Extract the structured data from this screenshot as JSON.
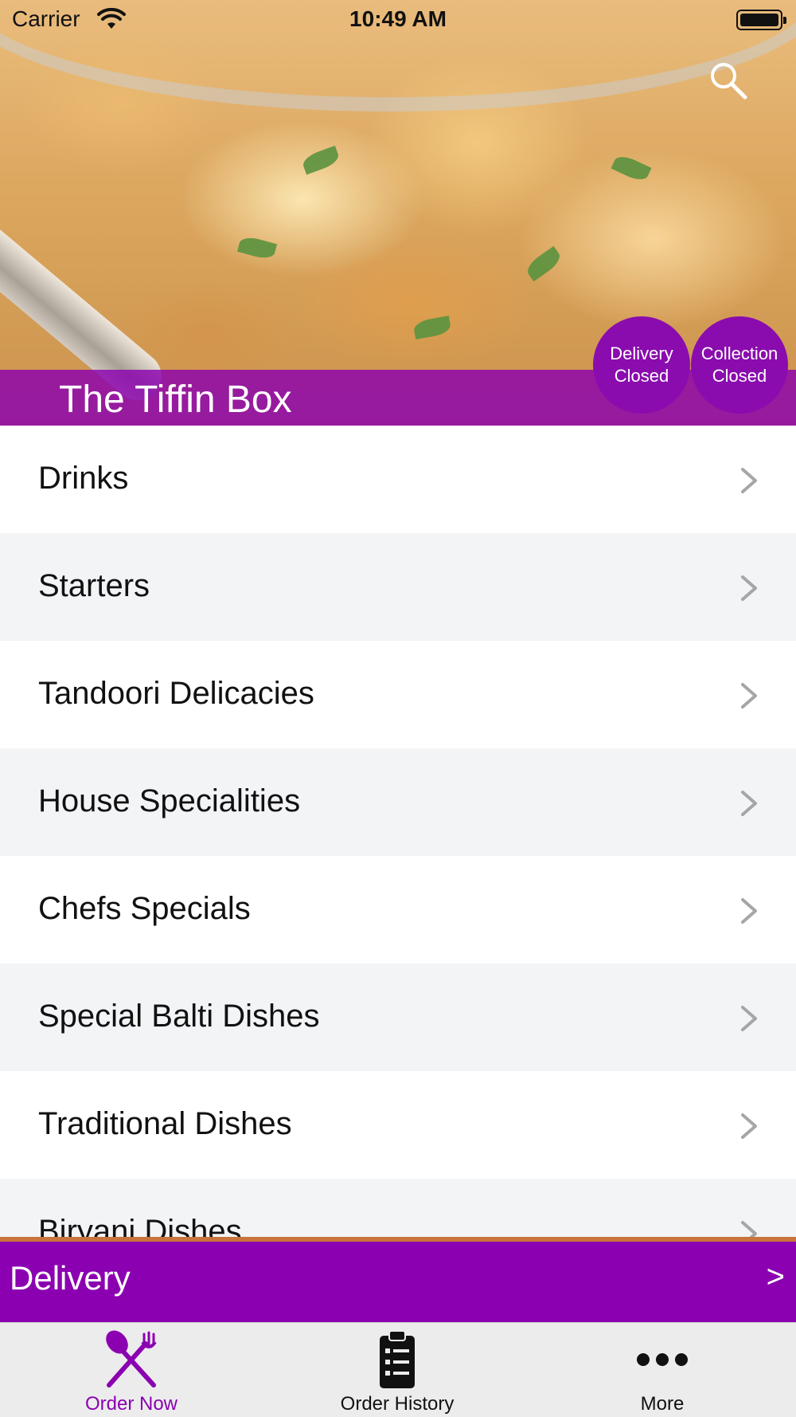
{
  "status_bar": {
    "carrier": "Carrier",
    "time": "10:49 AM"
  },
  "header": {
    "restaurant_name": "The Tiffin Box",
    "search_icon": "search-icon",
    "delivery_status": {
      "line1": "Delivery",
      "line2": "Closed"
    },
    "collection_status": {
      "line1": "Collection",
      "line2": "Closed"
    }
  },
  "menu": {
    "items": [
      {
        "label": "Drinks"
      },
      {
        "label": "Starters"
      },
      {
        "label": "Tandoori Delicacies"
      },
      {
        "label": "House Specialities"
      },
      {
        "label": "Chefs Specials"
      },
      {
        "label": "Special Balti Dishes"
      },
      {
        "label": "Traditional Dishes"
      },
      {
        "label": "Biryani Dishes"
      }
    ],
    "chevron_icon": "chevron-right-icon"
  },
  "delivery_bar": {
    "label": "Delivery",
    "arrow": ">"
  },
  "tabbar": {
    "tabs": [
      {
        "label": "Order Now",
        "icon": "fork-knife-icon",
        "active": true
      },
      {
        "label": "Order History",
        "icon": "clipboard-list-icon",
        "active": false
      },
      {
        "label": "More",
        "icon": "more-dots-icon",
        "active": false
      }
    ]
  },
  "colors": {
    "brand_purple": "#8b00b0",
    "delivery_bar_border": "#c8743c",
    "row_alt": "#f3f4f6",
    "tabbar_bg": "#ececed"
  }
}
